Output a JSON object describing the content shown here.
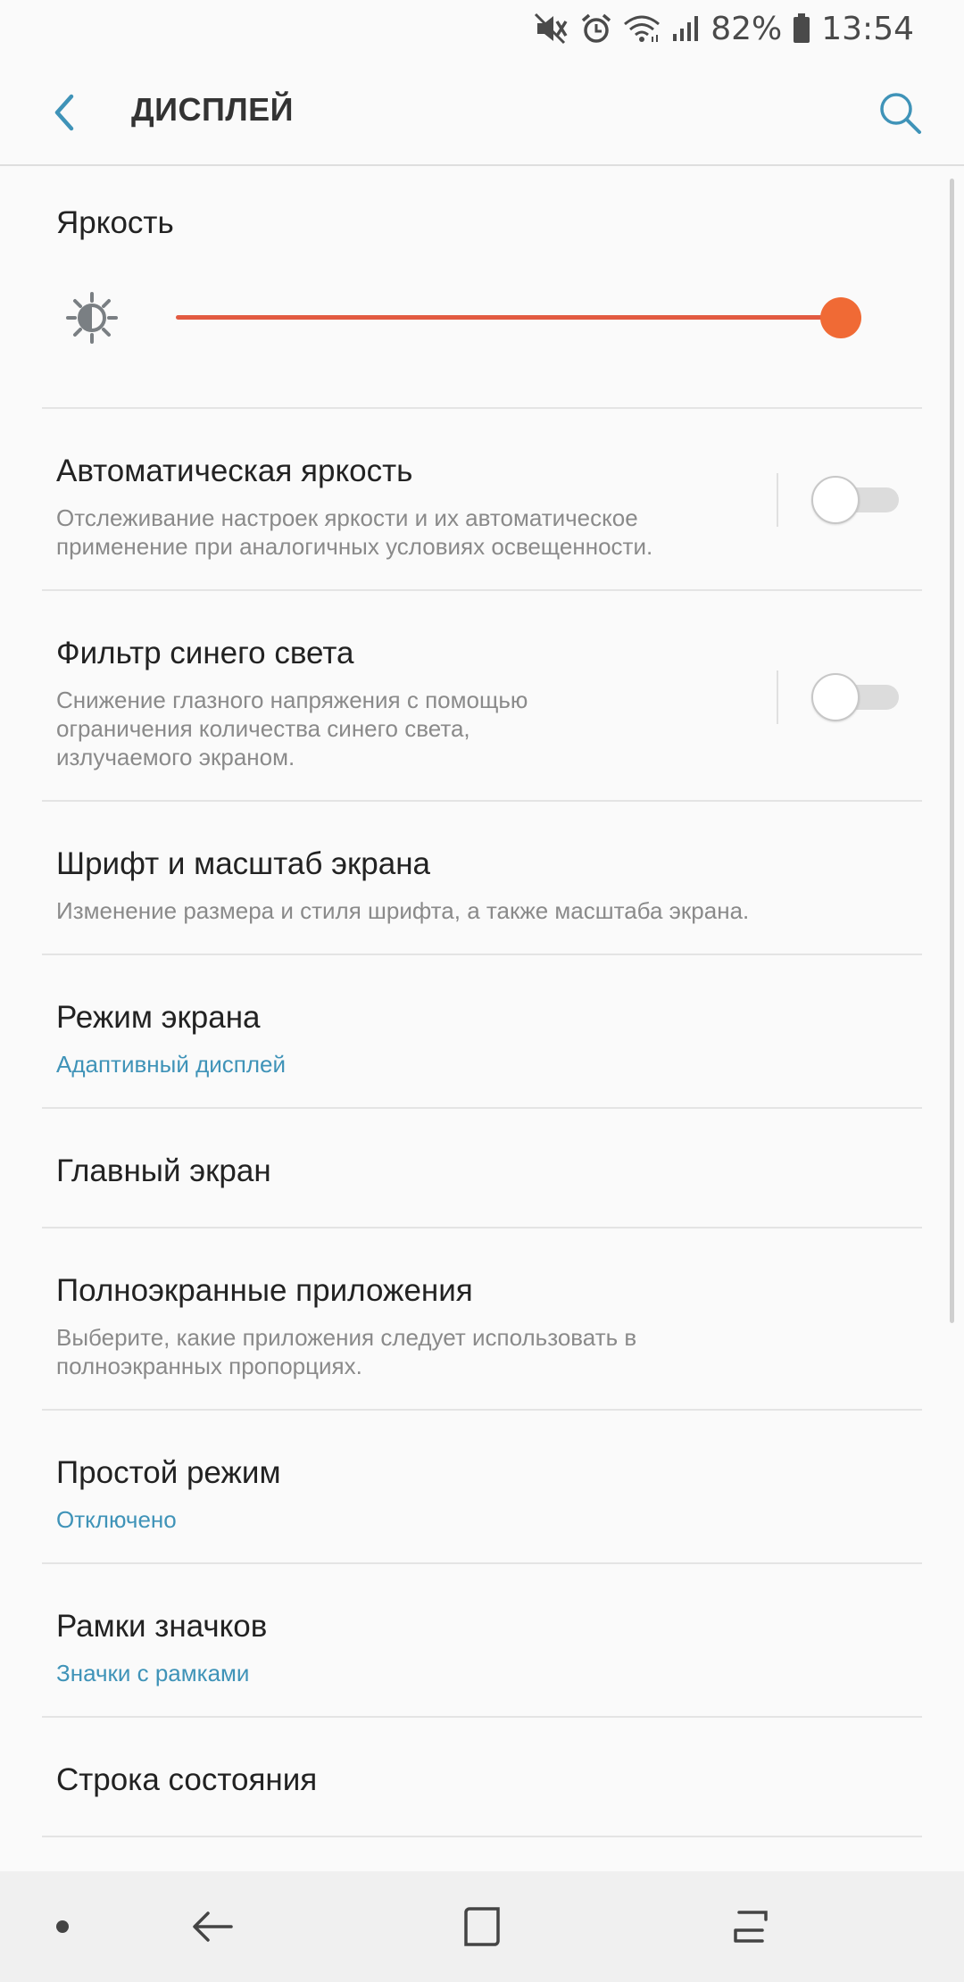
{
  "status_bar": {
    "battery_percent": "82%",
    "time": "13:54",
    "icons": [
      "mute-icon",
      "alarm-icon",
      "wifi-icon",
      "signal-icon",
      "battery-icon"
    ]
  },
  "header": {
    "title": "ДИСПЛЕЙ",
    "back_icon": "chevron-left-icon",
    "search_icon": "search-icon"
  },
  "brightness": {
    "title": "Яркость",
    "level_percent": 100,
    "accent_color": "#f06a35"
  },
  "settings": [
    {
      "id": "auto-brightness",
      "title": "Автоматическая яркость",
      "subtitle": "Отслеживание настроек яркости и их автоматическое применение при аналогичных условиях освещенности.",
      "toggle": false
    },
    {
      "id": "blue-light-filter",
      "title": "Фильтр синего света",
      "subtitle_lines": [
        "Снижение глазного напряжения с помощью",
        "ограничения количества синего света,",
        "излучаемого экраном."
      ],
      "toggle": false
    },
    {
      "id": "font-scale",
      "title": "Шрифт и масштаб экрана",
      "subtitle": "Изменение размера и стиля шрифта, а также масштаба экрана."
    },
    {
      "id": "screen-mode",
      "title": "Режим экрана",
      "value": "Адаптивный дисплей"
    },
    {
      "id": "home-screen",
      "title": "Главный экран"
    },
    {
      "id": "fullscreen-apps",
      "title": "Полноэкранные приложения",
      "subtitle": "Выберите, какие приложения следует использовать в полноэкранных пропорциях."
    },
    {
      "id": "easy-mode",
      "title": "Простой режим",
      "value": "Отключено"
    },
    {
      "id": "icon-frames",
      "title": "Рамки значков",
      "value": "Значки с рамками"
    },
    {
      "id": "status-bar",
      "title": "Строка состояния"
    }
  ],
  "nav_bar": {
    "icons": [
      "dot-icon",
      "back-arrow-icon",
      "home-square-icon",
      "recents-icon"
    ]
  },
  "colors": {
    "accent_blue": "#3f93b8",
    "slider_orange": "#f06a35"
  }
}
